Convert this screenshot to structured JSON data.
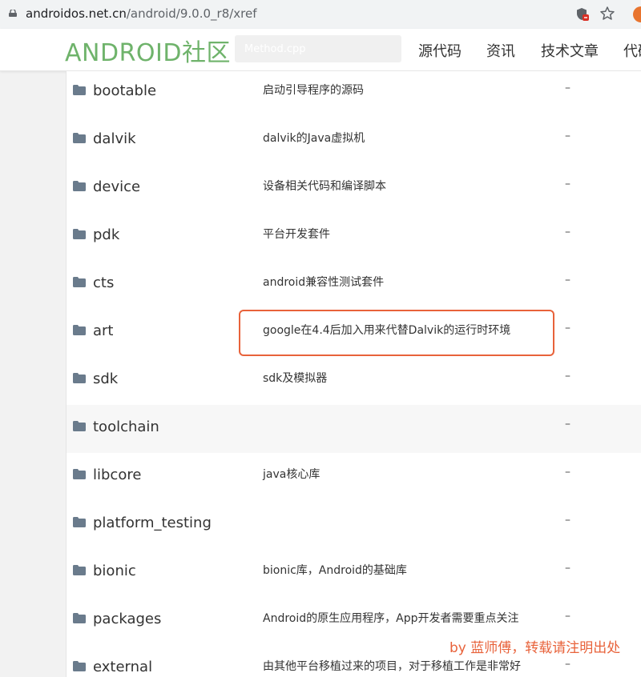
{
  "browser": {
    "url_host": "androidos.net.cn",
    "url_path": "/android/9.0.0_r8/xref"
  },
  "site": {
    "brand": "ANDROID社区",
    "search_placeholder": "Method.cpp",
    "nav": [
      "源代码",
      "资讯",
      "技术文章",
      "代码"
    ]
  },
  "colors": {
    "brand": "#6fb36b",
    "highlight": "#e8623a"
  },
  "rows": [
    {
      "name": "bootable",
      "desc": "启动引导程序的源码",
      "dash": "–"
    },
    {
      "name": "dalvik",
      "desc": "dalvik的Java虚拟机",
      "dash": "–"
    },
    {
      "name": "device",
      "desc": "设备相关代码和编译脚本",
      "dash": "–"
    },
    {
      "name": "pdk",
      "desc": "平台开发套件",
      "dash": "–"
    },
    {
      "name": "cts",
      "desc": "android兼容性测试套件",
      "dash": "–"
    },
    {
      "name": "art",
      "desc": "google在4.4后加入用来代替Dalvik的运行时环境",
      "dash": "–"
    },
    {
      "name": "sdk",
      "desc": "sdk及模拟器",
      "dash": "–"
    },
    {
      "name": "toolchain",
      "desc": "",
      "dash": "–"
    },
    {
      "name": "libcore",
      "desc": "java核心库",
      "dash": "–"
    },
    {
      "name": "platform_testing",
      "desc": "",
      "dash": "–"
    },
    {
      "name": "bionic",
      "desc": "bionic库，Android的基础库",
      "dash": "–"
    },
    {
      "name": "packages",
      "desc": "Android的原生应用程序，App开发者需要重点关注",
      "dash": "–"
    },
    {
      "name": "external",
      "desc": "由其他平台移植过来的项目，对于移植工作是非常好",
      "dash": "–"
    }
  ],
  "watermark": "by 蓝师傅，转载请注明出处"
}
